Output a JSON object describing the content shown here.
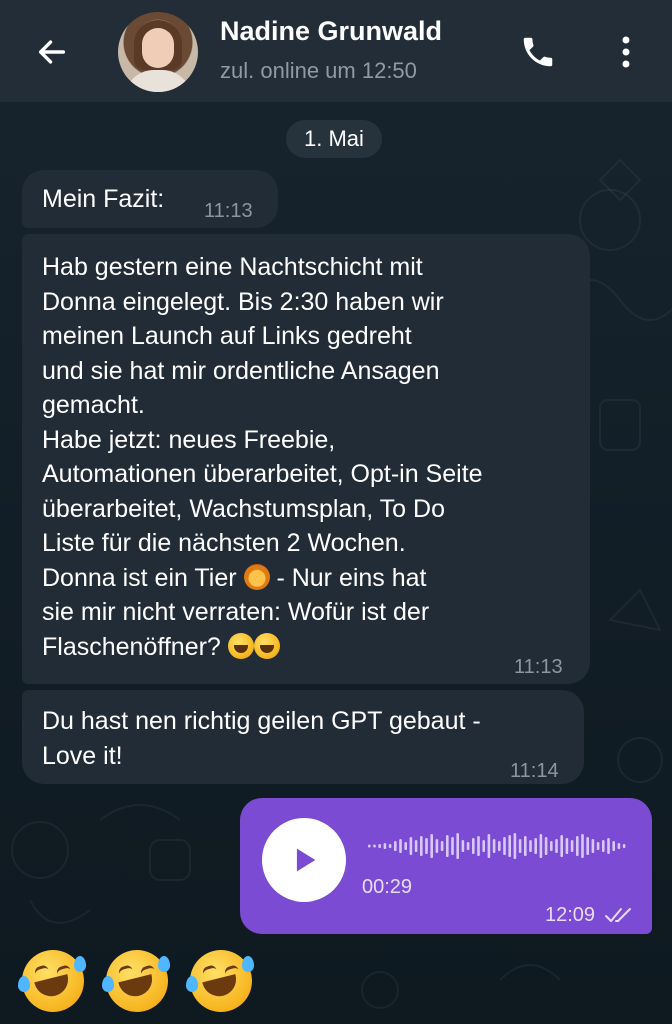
{
  "header": {
    "contact_name": "Nadine Grunwald",
    "status": "zul. online um 12:50",
    "icons": [
      "back-arrow-icon",
      "phone-icon",
      "more-vert-icon"
    ]
  },
  "chat": {
    "date_label": "1. Mai",
    "messages": [
      {
        "direction": "incoming",
        "text": "Mein Fazit:",
        "time": "11:13"
      },
      {
        "direction": "incoming",
        "text_parts": {
          "p1": "Hab gestern eine Nachtschicht mit\nDonna eingelegt. Bis 2:30 haben wir\nmeinen Launch auf Links gedreht\nund sie hat mir ordentliche Ansagen\ngemacht.\nHabe jetzt: neues Freebie,\nAutomationen überarbeitet, Opt-in Seite\nüberarbeitet, Wachstumsplan, To Do\nListe für die nächsten 2 Wochen.\nDonna ist ein Tier ",
          "p2": " - Nur eins hat\nsie mir nicht verraten: Wofür ist der\nFlaschenöffner? "
        },
        "emojis": [
          "lion-face-emoji",
          "tears-of-joy-emoji",
          "tears-of-joy-emoji"
        ],
        "time": "11:13"
      },
      {
        "direction": "incoming",
        "text": "Du hast nen richtig geilen GPT gebaut -\nLove it!",
        "time": "11:14"
      },
      {
        "direction": "outgoing",
        "type": "voice",
        "duration": "00:29",
        "time": "12:09",
        "status": "read",
        "icons": [
          "play-icon",
          "double-check-icon"
        ]
      }
    ],
    "pending_emojis": [
      "rolling-on-floor-laughing-emoji",
      "rolling-on-floor-laughing-emoji",
      "rolling-on-floor-laughing-emoji"
    ]
  },
  "colors": {
    "header_bg": "#222d37",
    "incoming_bubble": "#222c36",
    "outgoing_bubble": "#7b4bd4",
    "chat_bg": "#0f1a22",
    "muted_text": "#8a96a2"
  }
}
